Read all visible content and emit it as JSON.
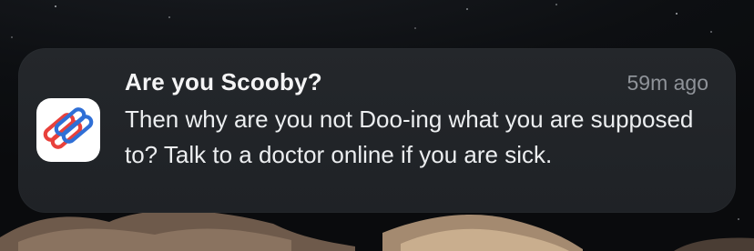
{
  "notification": {
    "title": "Are you Scooby?",
    "timestamp": "59m ago",
    "message": "Then why are you not Doo-ing what you are supposed to? Talk to a doctor online if you are sick.",
    "app_icon": "interlocking-chain-icon"
  },
  "colors": {
    "icon_red": "#e8413c",
    "icon_blue": "#2f6fd6",
    "card_background": "#222529",
    "title_text": "#f4f4f5",
    "timestamp_text": "#8f9399"
  }
}
